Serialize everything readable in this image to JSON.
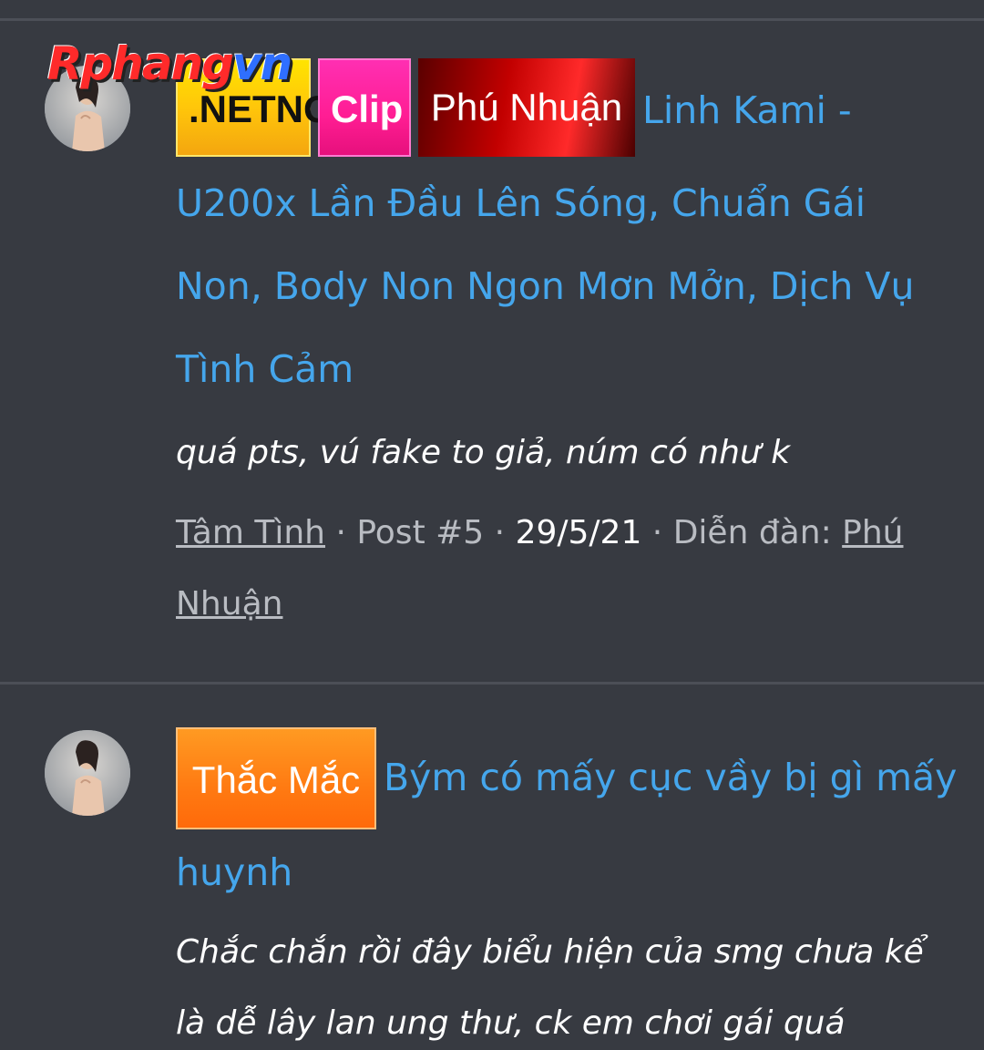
{
  "watermark": {
    "text_red": "Rphang",
    "text_blue": "vn"
  },
  "results": [
    {
      "prefixes": [
        {
          "label": ".NETNG",
          "style": "yellow"
        },
        {
          "label": "Clip",
          "style": "pink"
        },
        {
          "label": "Phú Nhuận",
          "style": "red"
        }
      ],
      "title": "Linh Kami - U200x Lần Đầu Lên Sóng, Chuẩn Gái Non, Body Non Ngon Mơn Mởn, Dịch Vụ Tình Cảm",
      "snippet": "quá pts, vú fake to giả, núm có như k",
      "meta": {
        "author": "Tâm Tình",
        "post": "Post #5",
        "date": "29/5/21",
        "forum_label": "Diễn đàn:",
        "forum": "Phú Nhuận",
        "separator": "·"
      }
    },
    {
      "prefixes": [
        {
          "label": "Thắc Mắc",
          "style": "orange"
        }
      ],
      "title": "Bým có mấy cục vầy bị gì mấy huynh",
      "snippet": "Chắc chắn rồi đây biểu hiện của smg chưa kể là dễ lây lan ung thư, ck em chơi gái quá"
    }
  ],
  "colors": {
    "background": "#373a41",
    "title_link": "#45a6ec",
    "meta_text": "#b9bcc2",
    "divider": "#4c4f57"
  }
}
